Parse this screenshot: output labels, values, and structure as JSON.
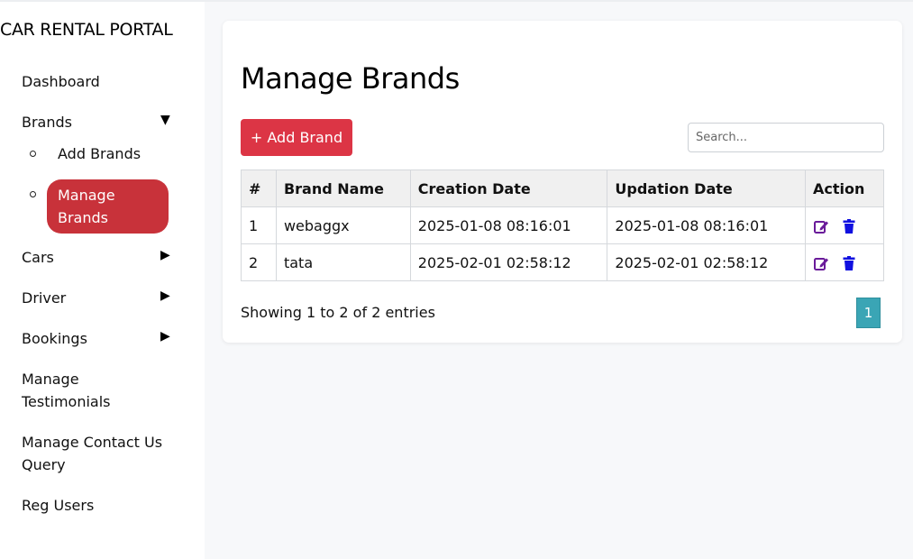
{
  "sidebar": {
    "title": "CAR RENTAL PORTAL",
    "dashboard": "Dashboard",
    "brands": "Brands",
    "brands_sub": {
      "add": "Add Brands",
      "manage_line1": "Manage",
      "manage_line2": "Brands"
    },
    "cars": "Cars",
    "driver": "Driver",
    "bookings": "Bookings",
    "testimonials_line1": "Manage",
    "testimonials_line2": "Testimonials",
    "contact_line1": "Manage Contact Us",
    "contact_line2": "Query",
    "reg_users": "Reg Users",
    "arrow_expanded": "▼",
    "arrow_collapsed": "▶"
  },
  "main": {
    "title": "Manage Brands",
    "add_button": "+ Add Brand",
    "search_placeholder": "Search...",
    "table": {
      "headers": [
        "#",
        "Brand Name",
        "Creation Date",
        "Updation Date",
        "Action"
      ],
      "rows": [
        {
          "num": "1",
          "name": "webaggx",
          "created": "2025-01-08 08:16:01",
          "updated": "2025-01-08 08:16:01"
        },
        {
          "num": "2",
          "name": "tata",
          "created": "2025-02-01 02:58:12",
          "updated": "2025-02-01 02:58:12"
        }
      ]
    },
    "footer": "Showing 1 to 2 of 2 entries",
    "page": "1"
  },
  "colors": {
    "accent_red": "#dc3545",
    "active_menu": "#c8323a",
    "pagination": "#3aa5b5",
    "edit_icon": "#6a1b9a",
    "delete_icon": "#1010e0"
  }
}
